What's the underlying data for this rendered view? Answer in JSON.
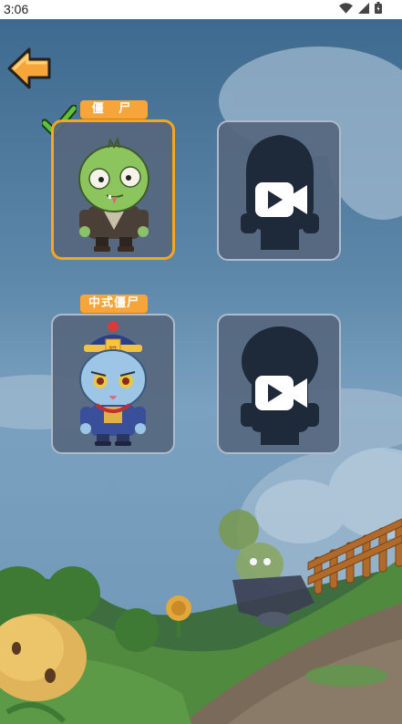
{
  "status_bar": {
    "time": "3:06",
    "icons": [
      "wifi-icon",
      "cellular-signal-icon",
      "battery-icon"
    ]
  },
  "back_button": {
    "icon": "back-arrow-icon",
    "color": "#f6a53a"
  },
  "characters": [
    {
      "label": "僵 尸",
      "selected": true,
      "locked": false,
      "character": "green-zombie"
    },
    {
      "label": "",
      "selected": false,
      "locked": true,
      "unlock_icon": "video-camera-icon"
    },
    {
      "label": "中式僵尸",
      "selected": false,
      "locked": false,
      "character": "jiangshi-zombie"
    },
    {
      "label": "",
      "selected": false,
      "locked": true,
      "unlock_icon": "video-camera-icon"
    }
  ],
  "colors": {
    "label_background": "#f6a53a",
    "selected_border": "#f5a623",
    "checkmark": "#5cc23a",
    "card_background": "#56677e"
  }
}
